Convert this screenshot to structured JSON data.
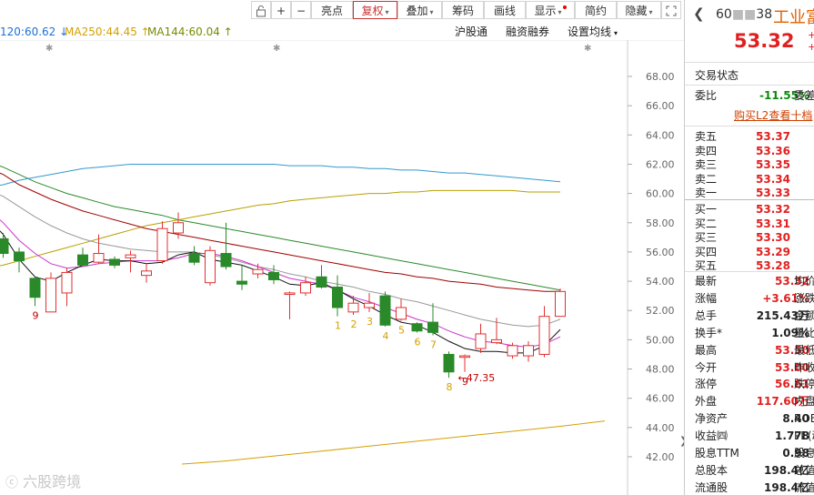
{
  "toolbar": {
    "lock_icon": "lock-icon",
    "zoom_in": "+",
    "zoom_out": "−",
    "buttons": [
      {
        "label": "亮点"
      },
      {
        "label": "复权",
        "arrow": "▾"
      },
      {
        "label": "叠加",
        "arrow": "▾"
      },
      {
        "label": "筹码"
      },
      {
        "label": "画线"
      },
      {
        "label": "显示",
        "arrow": "▾"
      },
      {
        "label": "简约"
      },
      {
        "label": "隐藏",
        "arrow": "▾"
      }
    ],
    "expand_icon": "expand-icon",
    "colors": {
      "active": "#cc3333"
    }
  },
  "legend": {
    "ma120": "120:60.62 ↓",
    "ma250": "MA250:44.45 ↑",
    "ma144": "MA144:60.04 ↑",
    "links": [
      "沪股通",
      "融资融券",
      "设置均线"
    ],
    "colors": {
      "ma120": "#1e6fd9",
      "ma250": "#d4a000",
      "ma144": "#7a8a00"
    }
  },
  "chart_data": {
    "type": "candlestick",
    "y_axis_ticks": [
      "68.00",
      "66.00",
      "64.00",
      "62.00",
      "60.00",
      "58.00",
      "56.00",
      "54.00",
      "52.00",
      "50.00",
      "48.00",
      "46.00",
      "44.00",
      "42.00"
    ],
    "ylim": [
      41.5,
      69.5
    ],
    "candles": [
      {
        "o": 57.2,
        "c": 57.8,
        "h": 58.4,
        "l": 56.9
      },
      {
        "o": 56.9,
        "c": 55.9,
        "h": 57.3,
        "l": 55.6
      },
      {
        "o": 56.0,
        "c": 55.4,
        "h": 56.3,
        "l": 54.6
      },
      {
        "o": 54.2,
        "c": 52.9,
        "h": 54.3,
        "l": 52.3
      },
      {
        "o": 51.9,
        "c": 54.2,
        "h": 54.6,
        "l": 51.9
      },
      {
        "o": 53.2,
        "c": 54.6,
        "h": 54.9,
        "l": 52.3
      },
      {
        "o": 55.8,
        "c": 55.1,
        "h": 56.3,
        "l": 55.0
      },
      {
        "o": 55.3,
        "c": 55.9,
        "h": 57.2,
        "l": 55.2
      },
      {
        "o": 55.5,
        "c": 55.1,
        "h": 55.7,
        "l": 54.9
      },
      {
        "o": 55.6,
        "c": 55.8,
        "h": 56.1,
        "l": 54.6
      },
      {
        "o": 54.4,
        "c": 54.7,
        "h": 55.2,
        "l": 53.9
      },
      {
        "o": 55.4,
        "c": 57.6,
        "h": 58.1,
        "l": 55.2
      },
      {
        "o": 57.3,
        "c": 58.0,
        "h": 58.7,
        "l": 56.9
      },
      {
        "o": 55.9,
        "c": 55.3,
        "h": 56.4,
        "l": 55.1
      },
      {
        "o": 53.9,
        "c": 56.1,
        "h": 56.4,
        "l": 53.7
      },
      {
        "o": 55.9,
        "c": 55.0,
        "h": 58.0,
        "l": 54.8
      },
      {
        "o": 54.0,
        "c": 53.8,
        "h": 55.1,
        "l": 53.4
      },
      {
        "o": 54.5,
        "c": 54.8,
        "h": 55.2,
        "l": 54.2
      },
      {
        "o": 54.6,
        "c": 54.1,
        "h": 55.1,
        "l": 53.8
      },
      {
        "o": 53.1,
        "c": 53.2,
        "h": 53.3,
        "l": 51.4
      },
      {
        "o": 53.2,
        "c": 53.9,
        "h": 54.3,
        "l": 53.0
      },
      {
        "o": 54.3,
        "c": 53.6,
        "h": 55.1,
        "l": 53.5
      },
      {
        "o": 53.6,
        "c": 52.2,
        "h": 54.4,
        "l": 51.6
      },
      {
        "o": 51.9,
        "c": 52.5,
        "h": 53.0,
        "l": 51.7
      },
      {
        "o": 52.2,
        "c": 52.5,
        "h": 53.2,
        "l": 51.9
      },
      {
        "o": 53.0,
        "c": 51.0,
        "h": 53.3,
        "l": 50.9
      },
      {
        "o": 51.4,
        "c": 52.2,
        "h": 52.8,
        "l": 51.3
      },
      {
        "o": 51.1,
        "c": 50.6,
        "h": 51.2,
        "l": 50.5
      },
      {
        "o": 51.2,
        "c": 50.5,
        "h": 52.5,
        "l": 50.3
      },
      {
        "o": 49.0,
        "c": 47.8,
        "h": 49.2,
        "l": 47.4
      },
      {
        "o": 48.8,
        "c": 48.9,
        "h": 49.0,
        "l": 47.8
      },
      {
        "o": 49.4,
        "c": 50.4,
        "h": 51.1,
        "l": 49.1
      },
      {
        "o": 49.8,
        "c": 50.0,
        "h": 51.5,
        "l": 49.7
      },
      {
        "o": 48.9,
        "c": 49.6,
        "h": 49.8,
        "l": 48.7
      },
      {
        "o": 48.9,
        "c": 49.6,
        "h": 49.9,
        "l": 48.5
      },
      {
        "o": 49.0,
        "c": 51.6,
        "h": 52.3,
        "l": 48.8
      },
      {
        "o": 51.6,
        "c": 53.3,
        "h": 53.5,
        "l": 51.6
      }
    ],
    "series": [
      {
        "values": [
          62.4,
          61.8,
          61.3,
          60.8,
          60.4,
          60.0,
          59.7,
          59.4,
          59.1,
          58.9,
          58.7,
          58.5,
          58.2,
          58.0,
          57.8,
          57.6,
          57.4,
          57.2,
          57.0,
          56.8,
          56.6,
          56.4,
          56.2,
          56.0,
          55.8,
          55.6,
          55.4,
          55.2,
          55.0,
          54.8,
          54.6,
          54.4,
          54.2,
          54.0,
          53.8,
          53.6,
          53.4
        ]
      },
      {
        "values": [
          60.3,
          60.6,
          60.9,
          61.1,
          61.3,
          61.5,
          61.7,
          61.8,
          61.9,
          62.0,
          62.0,
          62.0,
          62.0,
          62.0,
          62.0,
          62.0,
          62.0,
          62.0,
          62.0,
          61.9,
          61.9,
          61.9,
          61.8,
          61.8,
          61.7,
          61.7,
          61.6,
          61.6,
          61.5,
          61.4,
          61.4,
          61.3,
          61.2,
          61.1,
          61.0,
          60.9,
          60.8
        ]
      },
      {
        "values": [
          54.8,
          55.1,
          55.4,
          55.7,
          56.0,
          56.3,
          56.6,
          56.9,
          57.2,
          57.5,
          57.8,
          58.0,
          58.2,
          58.4,
          58.6,
          58.8,
          59.0,
          59.2,
          59.3,
          59.5,
          59.6,
          59.7,
          59.8,
          59.9,
          60.0,
          60.0,
          60.1,
          60.1,
          60.2,
          60.2,
          60.2,
          60.2,
          60.2,
          60.2,
          60.1,
          60.1,
          60.1
        ]
      },
      {
        "values": [
          62.0,
          61.3,
          60.6,
          60.1,
          59.6,
          59.2,
          58.8,
          58.5,
          58.2,
          57.9,
          57.6,
          57.4,
          57.2,
          57.0,
          56.8,
          56.6,
          56.4,
          56.2,
          56.0,
          55.8,
          55.6,
          55.4,
          55.2,
          55.0,
          54.8,
          54.6,
          54.5,
          54.3,
          54.2,
          54.0,
          53.9,
          53.8,
          53.6,
          53.5,
          53.4,
          53.3,
          53.3
        ]
      },
      {
        "values": [
          60.5,
          59.8,
          59.1,
          58.4,
          57.8,
          57.3,
          56.9,
          56.6,
          56.4,
          56.2,
          56.1,
          56.0,
          56.0,
          56.0,
          55.8,
          55.6,
          55.3,
          55.0,
          54.8,
          54.5,
          54.3,
          54.0,
          53.8,
          53.6,
          53.3,
          53.1,
          52.8,
          52.6,
          52.3,
          52.0,
          51.7,
          51.4,
          51.2,
          51.0,
          50.9,
          51.0,
          51.4
        ]
      },
      {
        "values": [
          59.5,
          58.0,
          56.8,
          55.9,
          55.2,
          54.9,
          55.0,
          55.2,
          55.3,
          55.4,
          55.4,
          55.4,
          55.6,
          55.9,
          55.9,
          55.7,
          55.4,
          55.0,
          54.6,
          54.2,
          54.0,
          53.8,
          53.4,
          52.9,
          52.6,
          52.2,
          51.8,
          51.4,
          51.1,
          50.6,
          50.2,
          49.9,
          49.8,
          49.6,
          49.5,
          49.7,
          50.2
        ]
      },
      {
        "values": [
          59.0,
          57.2,
          55.5,
          54.3,
          54.0,
          54.6,
          55.1,
          55.5,
          55.4,
          55.4,
          55.2,
          55.3,
          55.8,
          56.0,
          55.5,
          55.3,
          55.1,
          54.7,
          54.3,
          53.8,
          53.7,
          53.9,
          53.4,
          52.8,
          52.3,
          51.7,
          51.2,
          51.0,
          50.5,
          49.9,
          49.4,
          49.2,
          49.2,
          49.1,
          49.1,
          49.6,
          50.7
        ]
      }
    ],
    "series_colors": [
      "#2a8a2a",
      "#3399cc",
      "#b8a000",
      "#a00000",
      "#999999",
      "#cc33cc",
      "#111111"
    ],
    "ma250_line": {
      "values": [
        41.5,
        41.7,
        42.0,
        42.3,
        42.6,
        42.9,
        43.2,
        43.5,
        43.8,
        44.1,
        44.45
      ]
    },
    "annotations": [
      {
        "i": 3,
        "text": "9",
        "color": "#c00000"
      },
      {
        "i": 22,
        "text": "1",
        "color": "#d4a000"
      },
      {
        "i": 23,
        "text": "2",
        "color": "#d4a000"
      },
      {
        "i": 24,
        "text": "3",
        "color": "#d4a000"
      },
      {
        "i": 25,
        "text": "4",
        "color": "#d4a000"
      },
      {
        "i": 26,
        "text": "5",
        "color": "#d4a000"
      },
      {
        "i": 27,
        "text": "6",
        "color": "#d4a000"
      },
      {
        "i": 28,
        "text": "7",
        "color": "#d4a000"
      },
      {
        "i": 29,
        "text": "8",
        "color": "#d4a000"
      },
      {
        "i": 30,
        "text": "9",
        "color": "#c00000"
      }
    ],
    "low_label": "47.35",
    "up_color": "#e03030",
    "down_color": "#2a8a2a"
  },
  "watermark": "六股跨境",
  "panel": {
    "code": "60",
    "code_tail": "38",
    "name": "工业富",
    "price": "53.32",
    "change_hint": "+",
    "trade_status_label": "交易状态",
    "ratio_label": "委比",
    "ratio_value": "-11.55%",
    "ratio_right": "委差",
    "buy_l2": "购买L2查看十档",
    "asks": [
      {
        "label": "卖五",
        "price": "53.37"
      },
      {
        "label": "卖四",
        "price": "53.36"
      },
      {
        "label": "卖三",
        "price": "53.35"
      },
      {
        "label": "卖二",
        "price": "53.34"
      },
      {
        "label": "卖一",
        "price": "53.33"
      }
    ],
    "bids": [
      {
        "label": "买一",
        "price": "53.32"
      },
      {
        "label": "买二",
        "price": "53.31"
      },
      {
        "label": "买三",
        "price": "53.30"
      },
      {
        "label": "买四",
        "price": "53.29"
      },
      {
        "label": "买五",
        "price": "53.28"
      }
    ],
    "stats": [
      {
        "label": "最新",
        "value": "53.32",
        "color": "red",
        "right": "均价"
      },
      {
        "label": "涨幅",
        "value": "+3.61%",
        "color": "red",
        "right": "涨跌"
      },
      {
        "label": "总手",
        "value": "215.43万",
        "color": "black",
        "right": "金额"
      },
      {
        "label": "换手*",
        "value": "1.09%",
        "color": "black",
        "right": "量比"
      },
      {
        "label": "最高",
        "value": "53.50",
        "color": "red",
        "right": "最低"
      },
      {
        "label": "今开",
        "value": "53.00",
        "color": "red",
        "right": "昨收"
      },
      {
        "label": "涨停",
        "value": "56.61",
        "color": "red",
        "right": "跌停"
      },
      {
        "label": "外盘",
        "value": "117.60万",
        "color": "red",
        "right": "内盘"
      },
      {
        "label": "净资产",
        "value": "8.40",
        "color": "black",
        "right": "ROE"
      },
      {
        "label": "收益㈣",
        "value": "1.778",
        "color": "black",
        "right": "PE(动"
      },
      {
        "label": "股息TTM",
        "value": "0.98",
        "color": "black",
        "right": "股息"
      },
      {
        "label": "总股本",
        "value": "198.4亿",
        "color": "black",
        "right": "总值"
      },
      {
        "label": "流通股",
        "value": "198.4亿",
        "color": "black",
        "right": "流值"
      }
    ]
  }
}
